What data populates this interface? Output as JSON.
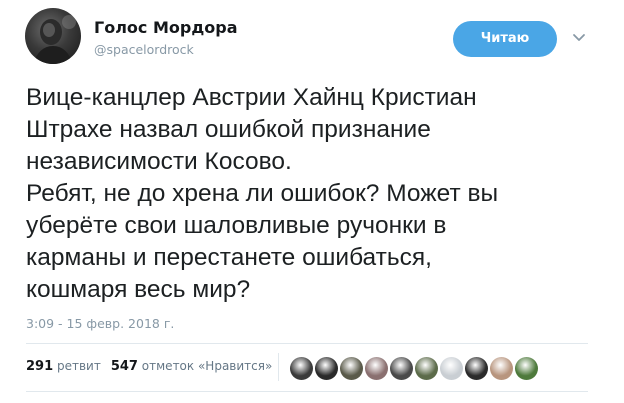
{
  "user": {
    "display_name": "Голос Мордора",
    "handle": "@spacelordrock"
  },
  "follow_button": {
    "label": "Читаю"
  },
  "tweet": {
    "lines": [
      "Вице-канцлер Австрии Хайнц Кристиан",
      "Штрахе назвал ошибкой признание",
      "независимости Косово.",
      "Ребят, не до хрена ли ошибок? Может вы",
      "уберёте свои шаловливые ручонки в",
      "карманы и перестанете ошибаться,",
      "кошмаря весь мир?"
    ],
    "timestamp": "3:09 - 15 февр. 2018 г."
  },
  "stats": {
    "retweets_count": "291",
    "retweets_label": "ретвит",
    "likes_count": "547",
    "likes_label": "отметок «Нравится»"
  },
  "likers": [
    {
      "name": "liker-avatar-1",
      "color": "#3b3b3b"
    },
    {
      "name": "liker-avatar-2",
      "color": "#2a2a2a"
    },
    {
      "name": "liker-avatar-3",
      "color": "#5a5a4a"
    },
    {
      "name": "liker-avatar-4",
      "color": "#8a7070"
    },
    {
      "name": "liker-avatar-5",
      "color": "#4a4a4a"
    },
    {
      "name": "liker-avatar-6",
      "color": "#5c6b4a"
    },
    {
      "name": "liker-avatar-7",
      "color": "#c9ced3"
    },
    {
      "name": "liker-avatar-8",
      "color": "#2b2b2b"
    },
    {
      "name": "liker-avatar-9",
      "color": "#b8957e"
    },
    {
      "name": "liker-avatar-10",
      "color": "#4e7a3c"
    }
  ],
  "colors": {
    "follow_button_bg": "#4aa6e6",
    "muted_text": "#8899a6",
    "divider": "#e1e8ed"
  }
}
